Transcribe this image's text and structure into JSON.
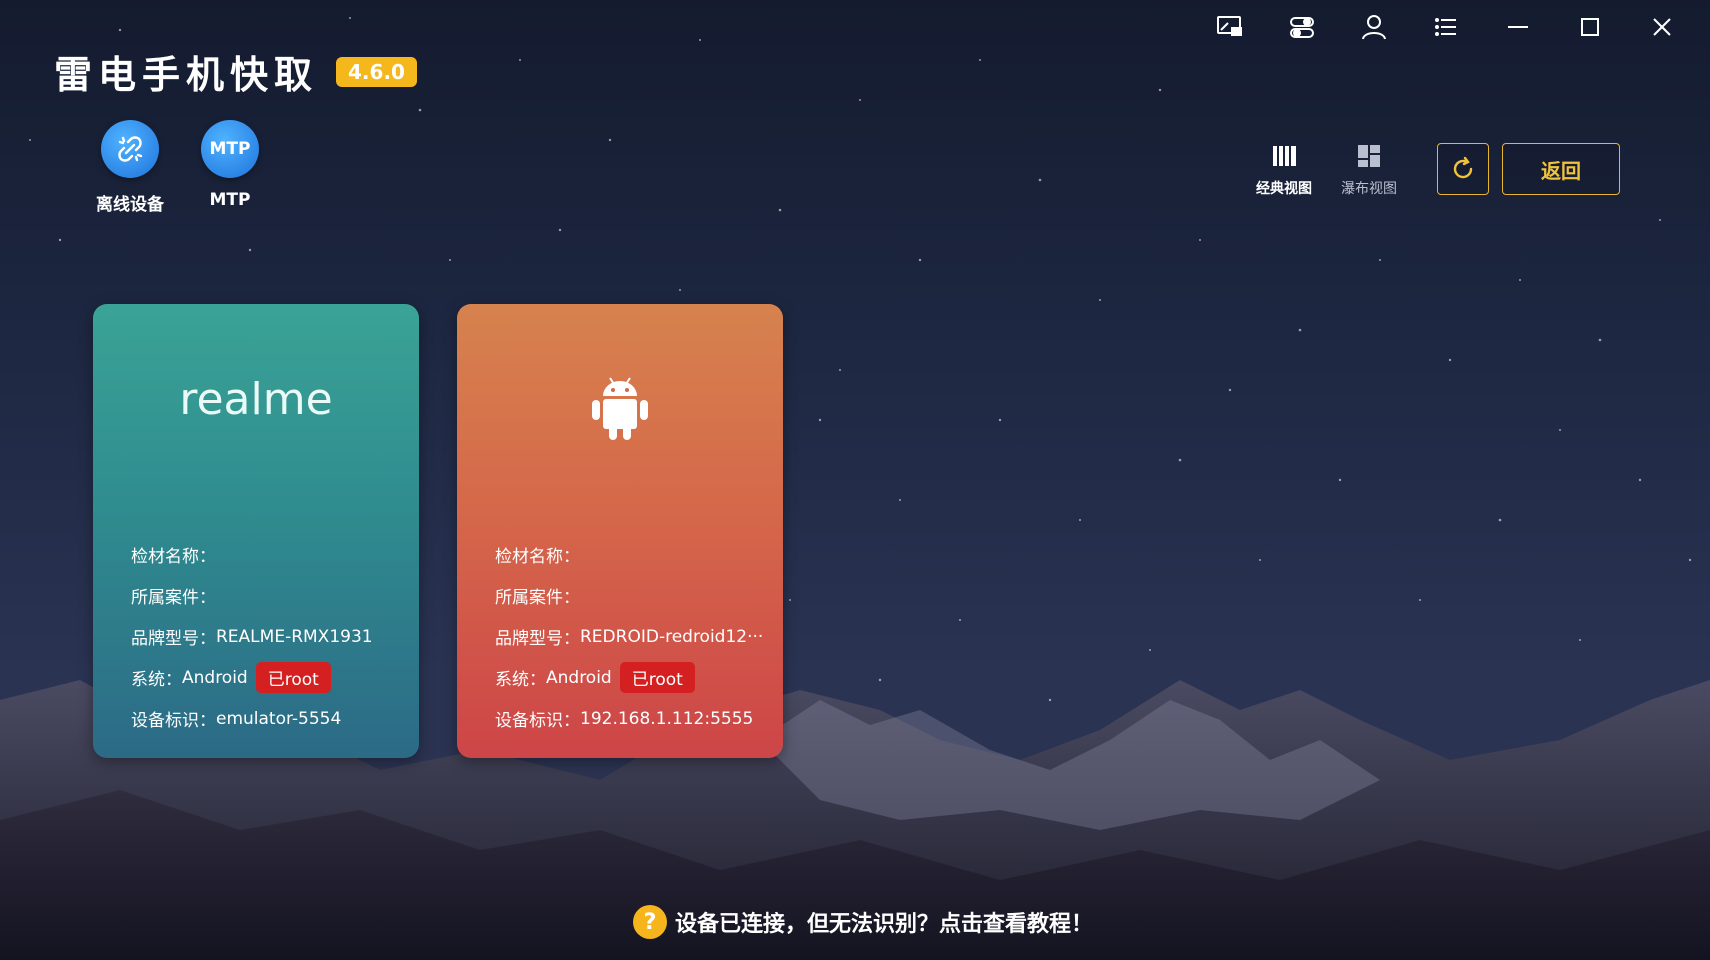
{
  "app": {
    "title": "雷电手机快取",
    "version": "4.6.0"
  },
  "window_controls": [
    {
      "icon": "screen-cast-icon"
    },
    {
      "icon": "toggle-settings-icon"
    },
    {
      "icon": "user-icon"
    },
    {
      "icon": "menu-icon"
    },
    {
      "icon": "minimize-icon"
    },
    {
      "icon": "maximize-icon"
    },
    {
      "icon": "close-icon"
    }
  ],
  "tools": [
    {
      "label": "离线设备",
      "icon": "unlink-icon"
    },
    {
      "label": "MTP",
      "icon_text": "MTP"
    }
  ],
  "views": {
    "classic": {
      "label": "经典视图",
      "active": true
    },
    "waterfall": {
      "label": "瀑布视图",
      "active": false
    }
  },
  "actions": {
    "back_label": "返回",
    "refresh_icon": "refresh-icon"
  },
  "devices": [
    {
      "brand_logo": "realme",
      "name_label": "检材名称：",
      "name_value": "",
      "case_label": "所属案件：",
      "case_value": "",
      "model_label": "品牌型号：",
      "model_value": "REALME-RMX1931",
      "system_label": "系统：",
      "system_value": "Android",
      "root_badge": "已root",
      "id_label": "设备标识：",
      "id_value": "emulator-5554",
      "colors": {
        "top": "#3aa396",
        "bottom": "#2c6a86"
      }
    },
    {
      "brand_logo": "android-icon",
      "name_label": "检材名称：",
      "name_value": "",
      "case_label": "所属案件：",
      "case_value": "",
      "model_label": "品牌型号：",
      "model_value": "REDROID-redroid12···",
      "system_label": "系统：",
      "system_value": "Android",
      "root_badge": "已root",
      "id_label": "设备标识：",
      "id_value": "192.168.1.112:5555",
      "colors": {
        "top": "#d6824e",
        "bottom": "#cd4548"
      }
    }
  ],
  "help": {
    "icon": "?",
    "text": "设备已连接，但无法识别？点击查看教程！"
  },
  "colors": {
    "accent": "#f5b81c",
    "button_border": "#e8b530",
    "root_badge": "#d42020",
    "tool_icon": "#2d86e6"
  }
}
